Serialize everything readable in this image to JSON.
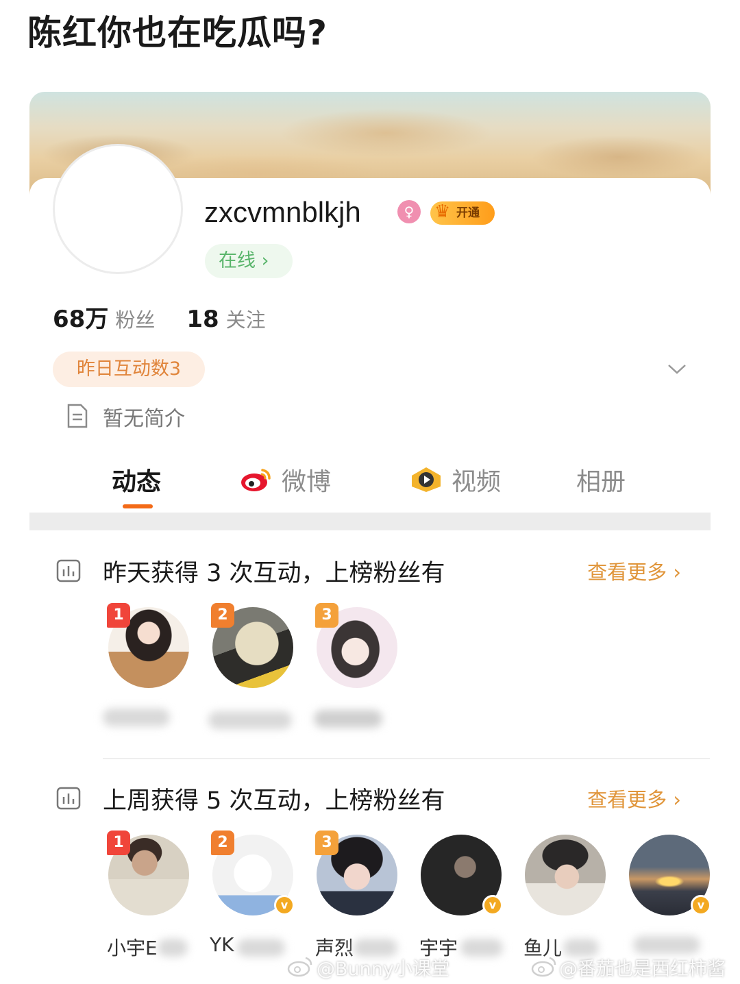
{
  "post": {
    "title": "陈红你也在吃瓜吗?"
  },
  "profile": {
    "username": "zxcvmnblkjh",
    "gender_icon": "female-icon",
    "gender_glyph": "♀",
    "vip_label": "开通",
    "online_label": "在线 ›",
    "followers_count": "68万",
    "followers_label": "粉丝",
    "following_count": "18",
    "following_label": "关注",
    "interaction_chip": "昨日互动数3",
    "bio": "暂无简介"
  },
  "tabs": [
    {
      "label": "动态",
      "icon": "",
      "active": true
    },
    {
      "label": "微博",
      "icon": "weibo-logo-icon",
      "active": false
    },
    {
      "label": "视频",
      "icon": "video-play-icon",
      "active": false
    },
    {
      "label": "相册",
      "icon": "",
      "active": false
    }
  ],
  "sections": [
    {
      "title": "昨天获得 3 次互动，上榜粉丝有",
      "see_more": "查看更多 ›",
      "fans": [
        {
          "rank": "1",
          "name": "",
          "verified": false
        },
        {
          "rank": "2",
          "name": "",
          "verified": false
        },
        {
          "rank": "3",
          "name": "",
          "verified": false
        }
      ]
    },
    {
      "title": "上周获得 5 次互动，上榜粉丝有",
      "see_more": "查看更多 ›",
      "fans": [
        {
          "rank": "1",
          "name": "小宇E",
          "verified": false
        },
        {
          "rank": "2",
          "name": "YK",
          "verified": true
        },
        {
          "rank": "3",
          "name": "声烈",
          "verified": false
        },
        {
          "rank": "",
          "name": "宇宇",
          "verified": true
        },
        {
          "rank": "",
          "name": "鱼儿",
          "verified": false
        },
        {
          "rank": "",
          "name": "",
          "verified": true
        }
      ]
    }
  ],
  "watermarks": [
    "@Bunny小课堂",
    "@番茄也是西红柿酱"
  ],
  "colors": {
    "accent": "#f36a17",
    "see_more": "#e0953a",
    "online_green": "#58b46a",
    "chip_orange": "#e0843a",
    "vip_gold": "#ffb830"
  }
}
